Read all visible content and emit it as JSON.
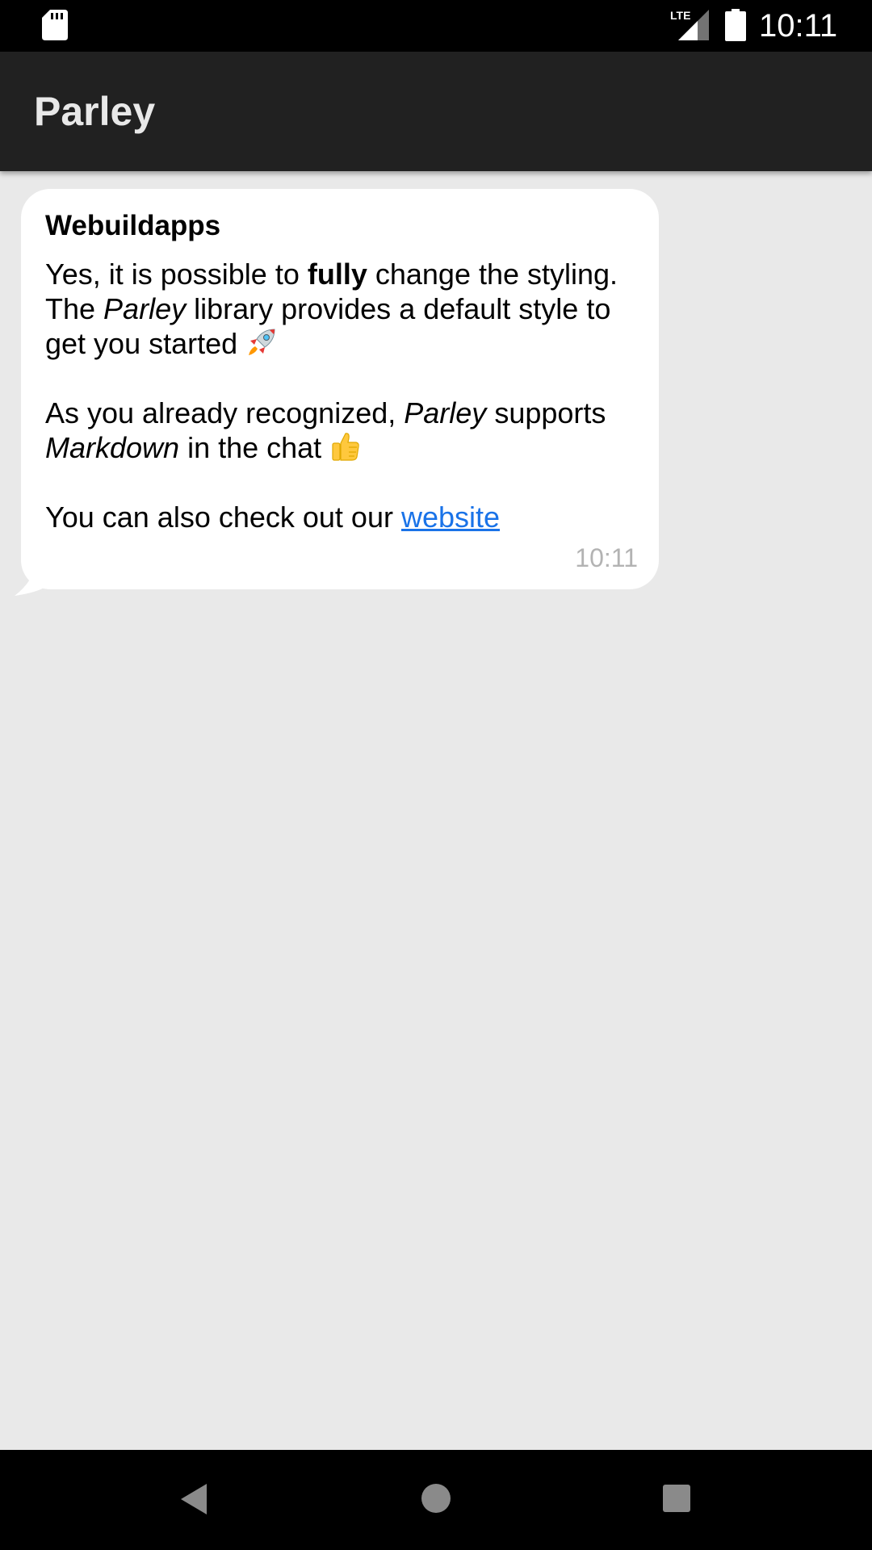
{
  "status_bar": {
    "time": "10:11",
    "network_label": "LTE",
    "icons": [
      "sd-card-icon",
      "lte-signal-icon",
      "battery-icon"
    ]
  },
  "app_bar": {
    "title": "Parley"
  },
  "message": {
    "sender": "Webuildapps",
    "line1_a": "Yes, it is possible to ",
    "line1_bold": "fully",
    "line1_b": " change the styling.",
    "line2_a": "The ",
    "line2_italic": "Parley",
    "line2_b": " library provides a default style to",
    "line3": "get you started ",
    "line4_a": "As you already recognized, ",
    "line4_italic": "Parley",
    "line4_b": " supports",
    "line5_italic": "Markdown",
    "line5_b": " in the chat ",
    "line6_a": "You can also check out our ",
    "link_text": "website",
    "time": "10:11",
    "emojis": [
      "rocket-emoji",
      "thumbs-up-emoji"
    ]
  },
  "nav_bar": {
    "icons": [
      "back-icon",
      "home-icon",
      "recents-icon"
    ]
  },
  "colors": {
    "status_bar": "#000000",
    "app_bar": "#212121",
    "background": "#e9e9e9",
    "bubble": "#ffffff",
    "link": "#1a73e8",
    "timestamp": "#b3b3b3"
  }
}
